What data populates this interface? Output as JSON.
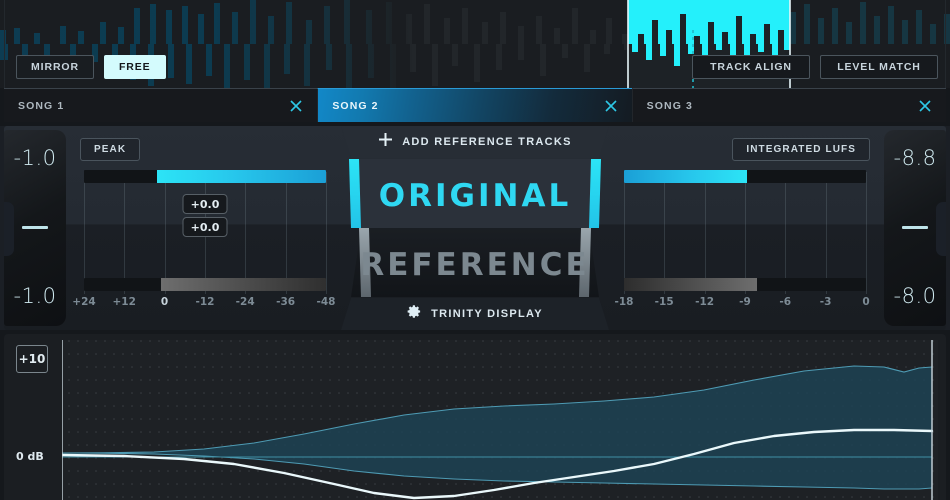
{
  "toolbar": {
    "mirror_label": "MIRROR",
    "free_label": "FREE",
    "track_align_label": "TRACK ALIGN",
    "level_match_label": "LEVEL MATCH"
  },
  "tabs": [
    {
      "label": "SONG 1",
      "selected": false,
      "close_icon": "close-icon"
    },
    {
      "label": "SONG 2",
      "selected": true,
      "close_icon": "close-icon"
    },
    {
      "label": "SONG 3",
      "selected": false,
      "close_icon": "close-icon"
    }
  ],
  "center": {
    "add_reference_label": "ADD REFERENCE TRACKS",
    "add_icon": "plus-icon",
    "original_label": "ORIGINAL",
    "reference_label": "REFERENCE",
    "trinity_label": "TRINITY DISPLAY",
    "settings_icon": "gear-icon"
  },
  "left_meter": {
    "mode_label": "PEAK",
    "value_top": "-1.0",
    "value_bottom": "-1.0",
    "badge_top": "+0.0",
    "badge_bottom": "+0.0",
    "scale": [
      "+24",
      "+12",
      "0",
      "-12",
      "-24",
      "-36",
      "-48"
    ],
    "zero_index": 2,
    "original_fill_pct": 70,
    "reference_fill_pct": 71
  },
  "right_meter": {
    "mode_label": "INTEGRATED LUFS",
    "value_top": "-8.8",
    "value_bottom": "-8.0",
    "scale": [
      "-18",
      "-15",
      "-12",
      "-9",
      "-6",
      "-3",
      "0"
    ],
    "original_fill_pct": 51,
    "reference_fill_pct": 55
  },
  "spectrum": {
    "top_label": "+10",
    "zero_label": "0 dB"
  },
  "colors": {
    "accent_cyan": "#2ce4f6",
    "accent_blue": "#1288c8",
    "panel": "#272d35",
    "background": "#15181c",
    "reference_gray": "#7c8890"
  },
  "chart_data": {
    "type": "area",
    "title": "",
    "xlabel": "",
    "ylabel": "dB",
    "ylim": [
      -10,
      10
    ],
    "grid": "dotted",
    "series": [
      {
        "name": "reference-band-upper",
        "values": [
          0.6,
          0.6,
          0.7,
          0.9,
          1.4,
          2.3,
          3.4,
          4.4,
          5.0,
          5.2,
          5.0,
          4.6,
          4.3,
          4.3,
          4.6,
          5.4,
          6.4,
          7.2,
          7.6,
          7.3,
          7.5,
          7.6
        ]
      },
      {
        "name": "reference-band-lower",
        "values": [
          -0.4,
          -0.4,
          -0.6,
          -1.1,
          -2.0,
          -3.2,
          -4.5,
          -5.6,
          -6.3,
          -6.6,
          -6.8,
          -7.0,
          -7.2,
          -7.4,
          -7.6,
          -7.8,
          -8.0,
          -8.2,
          -8.4,
          -8.5,
          -8.6,
          -8.6
        ]
      },
      {
        "name": "original-curve",
        "values": [
          -0.2,
          -0.3,
          -0.6,
          -1.2,
          -2.2,
          -3.6,
          -5.0,
          -6.1,
          -6.6,
          -6.2,
          -5.4,
          -4.6,
          -3.9,
          -3.2,
          -2.2,
          -1.0,
          0.1,
          0.8,
          1.1,
          1.2,
          1.2,
          1.1
        ]
      },
      {
        "name": "zero-reference-line",
        "values": [
          0,
          0,
          0,
          0,
          0,
          0,
          0,
          0,
          0,
          0,
          0,
          0,
          0,
          0,
          0,
          0,
          0,
          0,
          0,
          0,
          0,
          0
        ]
      }
    ]
  },
  "waveform": {
    "selection_start_pct": 66.1,
    "selection_end_pct": 83.1,
    "playhead_pct": 72.9
  }
}
